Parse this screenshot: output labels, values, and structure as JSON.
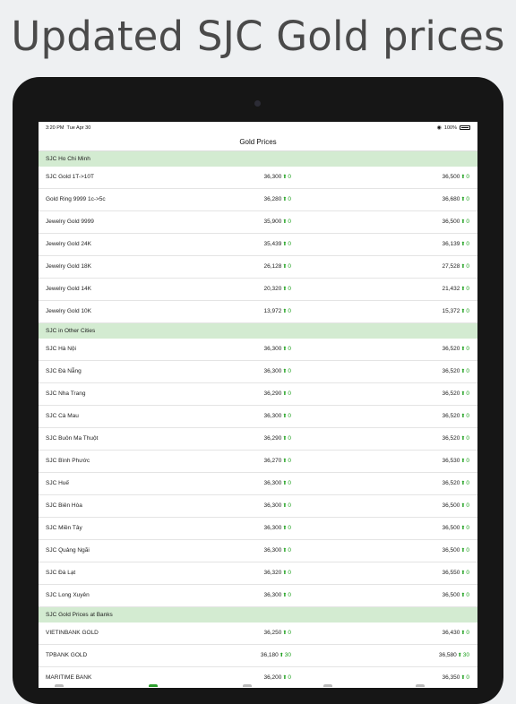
{
  "banner": {
    "title": "Updated SJC Gold prices"
  },
  "status_bar": {
    "time": "3:20 PM",
    "date": "Tue Apr 30",
    "battery": "100%"
  },
  "nav": {
    "title": "Gold Prices"
  },
  "colors": {
    "section_bg": "#d3ebd1",
    "up": "#1fa01f"
  },
  "icons": {
    "up": "up-arrow-icon",
    "wifi": "wifi-icon",
    "battery": "battery-icon"
  },
  "sections": [
    {
      "title": "SJC Ho Chi Minh",
      "rows": [
        {
          "name": "SJC Gold 1T->10T",
          "buy": "36,300",
          "buy_change": "0",
          "sell": "36,500",
          "sell_change": "0"
        },
        {
          "name": "Gold Ring 9999 1c->5c",
          "buy": "36,280",
          "buy_change": "0",
          "sell": "36,680",
          "sell_change": "0"
        },
        {
          "name": "Jewelry Gold 9999",
          "buy": "35,900",
          "buy_change": "0",
          "sell": "36,500",
          "sell_change": "0"
        },
        {
          "name": "Jewelry Gold 24K",
          "buy": "35,439",
          "buy_change": "0",
          "sell": "36,139",
          "sell_change": "0"
        },
        {
          "name": "Jewelry Gold 18K",
          "buy": "26,128",
          "buy_change": "0",
          "sell": "27,528",
          "sell_change": "0"
        },
        {
          "name": "Jewelry Gold 14K",
          "buy": "20,320",
          "buy_change": "0",
          "sell": "21,432",
          "sell_change": "0"
        },
        {
          "name": "Jewelry Gold 10K",
          "buy": "13,972",
          "buy_change": "0",
          "sell": "15,372",
          "sell_change": "0"
        }
      ]
    },
    {
      "title": "SJC in Other Cities",
      "rows": [
        {
          "name": "SJC Hà Nội",
          "buy": "36,300",
          "buy_change": "0",
          "sell": "36,520",
          "sell_change": "0"
        },
        {
          "name": "SJC Đà Nẵng",
          "buy": "36,300",
          "buy_change": "0",
          "sell": "36,520",
          "sell_change": "0"
        },
        {
          "name": "SJC Nha Trang",
          "buy": "36,290",
          "buy_change": "0",
          "sell": "36,520",
          "sell_change": "0"
        },
        {
          "name": "SJC Cà Mau",
          "buy": "36,300",
          "buy_change": "0",
          "sell": "36,520",
          "sell_change": "0"
        },
        {
          "name": "SJC Buôn Ma Thuột",
          "buy": "36,290",
          "buy_change": "0",
          "sell": "36,520",
          "sell_change": "0"
        },
        {
          "name": "SJC Bình Phước",
          "buy": "36,270",
          "buy_change": "0",
          "sell": "36,530",
          "sell_change": "0"
        },
        {
          "name": "SJC Huế",
          "buy": "36,300",
          "buy_change": "0",
          "sell": "36,520",
          "sell_change": "0"
        },
        {
          "name": "SJC Biên Hòa",
          "buy": "36,300",
          "buy_change": "0",
          "sell": "36,500",
          "sell_change": "0"
        },
        {
          "name": "SJC Miền Tây",
          "buy": "36,300",
          "buy_change": "0",
          "sell": "36,500",
          "sell_change": "0"
        },
        {
          "name": "SJC Quảng Ngãi",
          "buy": "36,300",
          "buy_change": "0",
          "sell": "36,500",
          "sell_change": "0"
        },
        {
          "name": "SJC Đà Lạt",
          "buy": "36,320",
          "buy_change": "0",
          "sell": "36,550",
          "sell_change": "0"
        },
        {
          "name": "SJC Long Xuyên",
          "buy": "36,300",
          "buy_change": "0",
          "sell": "36,500",
          "sell_change": "0"
        }
      ]
    },
    {
      "title": "SJC Gold Prices at Banks",
      "rows": [
        {
          "name": "VIETINBANK GOLD",
          "buy": "36,250",
          "buy_change": "0",
          "sell": "36,430",
          "sell_change": "0"
        },
        {
          "name": "TPBANK GOLD",
          "buy": "36,180",
          "buy_change": "30",
          "sell": "36,580",
          "sell_change": "30"
        },
        {
          "name": "MARITIME BANK",
          "buy": "36,200",
          "buy_change": "0",
          "sell": "36,350",
          "sell_change": "0"
        }
      ]
    }
  ]
}
